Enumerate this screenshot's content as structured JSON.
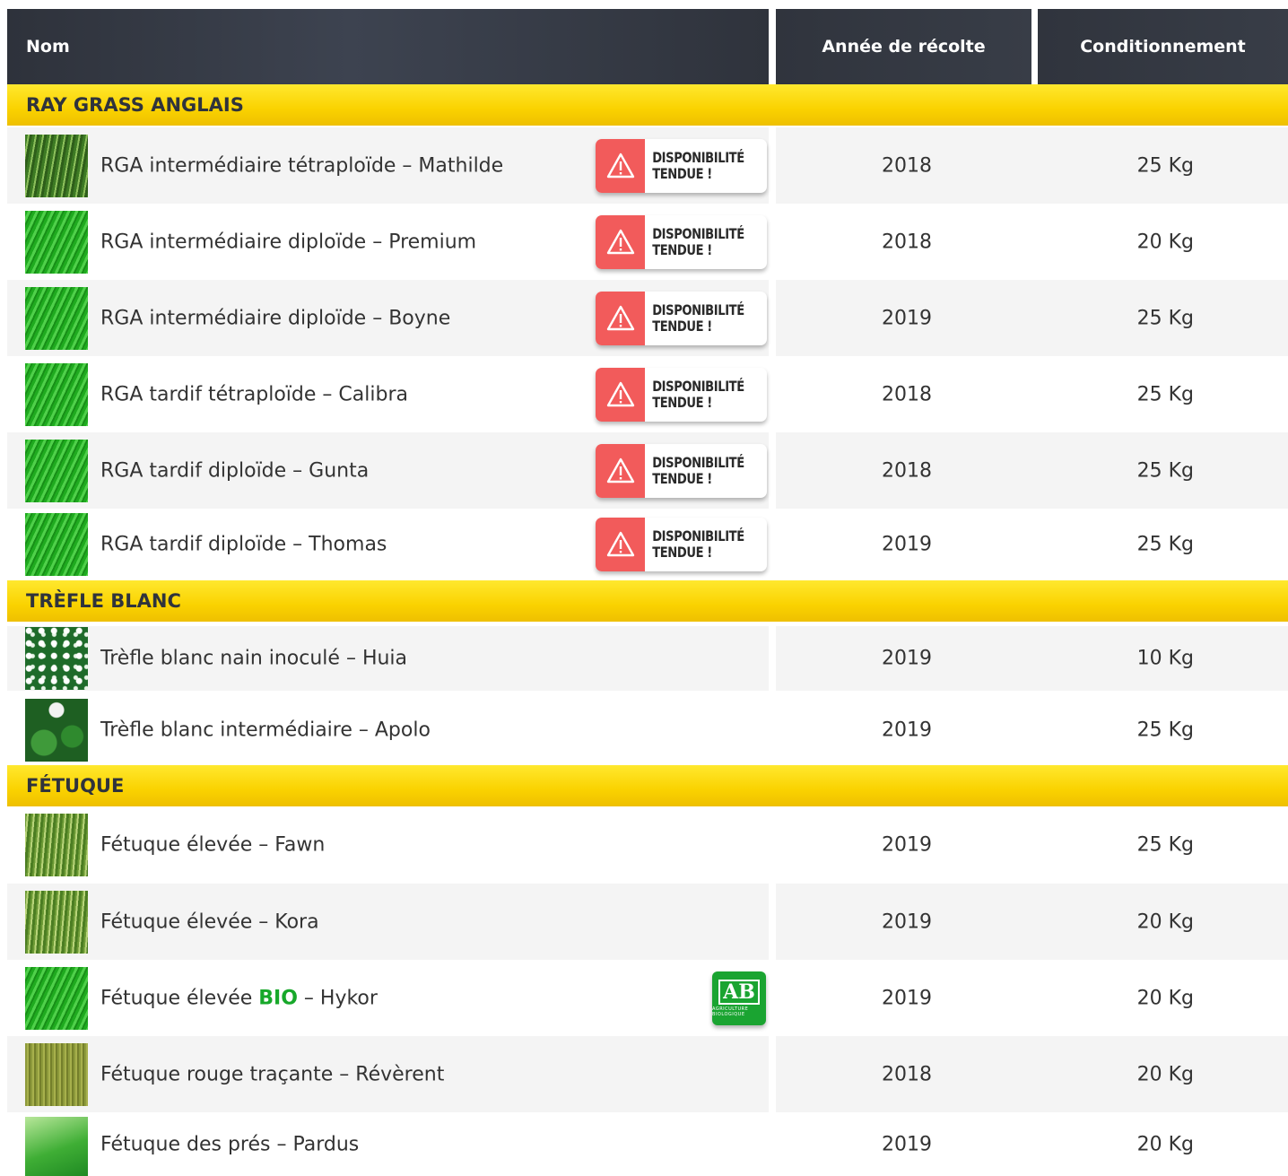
{
  "header": {
    "nom": "Nom",
    "annee": "Année de récolte",
    "conditionnement": "Conditionnement"
  },
  "badge": {
    "line1": "DISPONIBILITÉ",
    "line2": "TENDUE !"
  },
  "sections": {
    "ray_grass": "RAY GRASS ANGLAIS",
    "trefle": "TRÈFLE BLANC",
    "fetuque": "FÉTUQUE"
  },
  "rows": [
    {
      "name": "RGA intermédiaire tétraploïde – Mathilde",
      "year": "2018",
      "pack": "25 Kg",
      "thumb": "dark-grass-icon",
      "badge": true
    },
    {
      "name": "RGA intermédiaire diploïde – Premium",
      "year": "2018",
      "pack": "20 Kg",
      "thumb": "grass-icon",
      "badge": true
    },
    {
      "name": "RGA intermédiaire diploïde – Boyne",
      "year": "2019",
      "pack": "25 Kg",
      "thumb": "grass-icon",
      "badge": true
    },
    {
      "name": "RGA tardif tétraploïde – Calibra",
      "year": "2018",
      "pack": "25 Kg",
      "thumb": "grass-icon",
      "badge": true
    },
    {
      "name": "RGA tardif diploïde – Gunta",
      "year": "2018",
      "pack": "25 Kg",
      "thumb": "grass-icon",
      "badge": true
    },
    {
      "name": "RGA tardif diploïde – Thomas",
      "year": "2019",
      "pack": "25 Kg",
      "thumb": "grass-icon",
      "badge": true
    },
    {
      "name": "Trèfle blanc nain inoculé – Huia",
      "year": "2019",
      "pack": "10 Kg",
      "thumb": "clover-field-icon"
    },
    {
      "name": "Trèfle blanc intermédiaire – Apolo",
      "year": "2019",
      "pack": "25 Kg",
      "thumb": "clover-flower-icon"
    },
    {
      "name": "Fétuque élevée – Fawn",
      "year": "2019",
      "pack": "25 Kg",
      "thumb": "fescue-icon"
    },
    {
      "name": "Fétuque élevée – Kora",
      "year": "2019",
      "pack": "20 Kg",
      "thumb": "fescue-icon"
    },
    {
      "name_prefix": "Fétuque élevée ",
      "name_bio": "BIO",
      "name_suffix": " – Hykor",
      "year": "2019",
      "pack": "20 Kg",
      "thumb": "grass-icon",
      "ab_logo": {
        "main": "AB",
        "small": "AGRICULTURE BIOLOGIQUE"
      }
    },
    {
      "name": "Fétuque rouge traçante – Révèrent",
      "year": "2018",
      "pack": "20 Kg",
      "thumb": "olive-grass-icon"
    },
    {
      "name": "Fétuque des prés – Pardus",
      "year": "2019",
      "pack": "20 Kg",
      "thumb": "meadow-grass-icon"
    }
  ],
  "colors": {
    "header_bg": "#363b45",
    "section_bg": "#fad200",
    "badge_red": "#f25b5b",
    "bio_green": "#17a82a"
  }
}
